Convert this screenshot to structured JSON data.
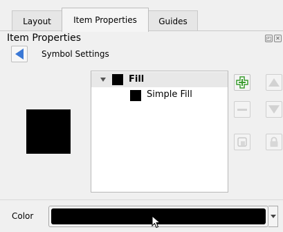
{
  "tabs": [
    {
      "label": "Layout",
      "active": false
    },
    {
      "label": "Item Properties",
      "active": true
    },
    {
      "label": "Guides",
      "active": false
    }
  ],
  "panel": {
    "title": "Item Properties",
    "buttons": [
      {
        "icon": "float-icon"
      },
      {
        "icon": "close-icon"
      }
    ]
  },
  "symbol": {
    "back_icon": "back-arrow-icon",
    "subtitle": "Symbol Settings",
    "preview_color": "#000000"
  },
  "layers": [
    {
      "label": "Fill",
      "bold": true,
      "expanded": true,
      "selected": true,
      "swatch": "#000000"
    },
    {
      "label": "Simple Fill",
      "bold": false,
      "selected": false,
      "swatch": "#000000"
    }
  ],
  "side_buttons": [
    {
      "name": "add-layer-button",
      "icon": "green-plus-icon",
      "enabled": true
    },
    {
      "name": "move-up-button",
      "icon": "arrow-up-icon",
      "enabled": false
    },
    {
      "name": "remove-layer-button",
      "icon": "minus-icon",
      "enabled": false
    },
    {
      "name": "move-down-button",
      "icon": "arrow-down-icon",
      "enabled": false
    },
    {
      "name": "duplicate-layer-button",
      "icon": "duplicate-icon",
      "enabled": false
    },
    {
      "name": "lock-layer-button",
      "icon": "lock-icon",
      "enabled": false
    }
  ],
  "color": {
    "label": "Color",
    "value": "#000000"
  },
  "colors": {
    "accent": "#3a78d6",
    "add_green": "#3a9b2f"
  }
}
